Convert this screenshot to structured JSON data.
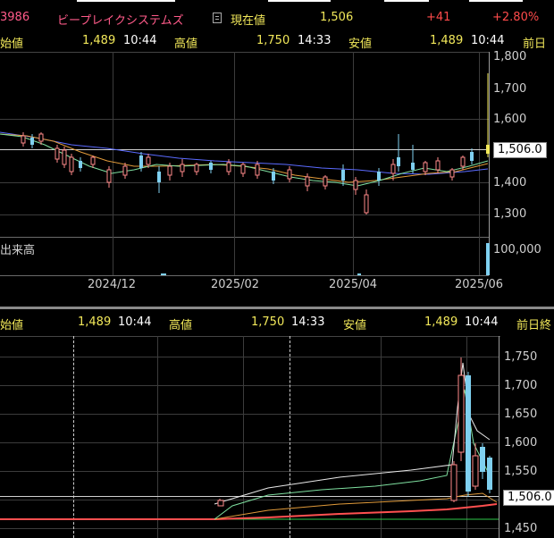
{
  "header": {
    "code": "3986",
    "name": "ビープレイクシステムズ",
    "current_label": "現在値",
    "current_value": "1,506",
    "change": "+41",
    "change_pct": "+2.80%"
  },
  "top_stats": {
    "open_label": "始値",
    "open_value": "1,489",
    "open_time": "10:44",
    "high_label": "高値",
    "high_value": "1,750",
    "high_time": "14:33",
    "low_label": "安値",
    "low_value": "1,489",
    "low_time": "10:44",
    "prev_label": "前日"
  },
  "daily_chart": {
    "y_ticks": [
      "1,800",
      "1,700",
      "1,600",
      "1,506.0",
      "1,400",
      "1,300"
    ],
    "volume_label": "出来高",
    "volume_tick": "100,000",
    "x_ticks": [
      "2024/12",
      "2025/02",
      "2025/04",
      "2025/06"
    ]
  },
  "bottom_stats": {
    "open_label": "始値",
    "open_value": "1,489",
    "open_time": "10:44",
    "high_label": "高値",
    "high_value": "1,750",
    "high_time": "14:33",
    "low_label": "安値",
    "low_value": "1,489",
    "low_time": "10:44",
    "prev_label": "前日終"
  },
  "intraday_chart": {
    "y_ticks": [
      "1,750",
      "1,700",
      "1,650",
      "1,600",
      "1,550",
      "1,506.0",
      "1,450"
    ]
  },
  "colors": {
    "accent_yellow": "#f2e85a",
    "up_red": "#ff4b4b",
    "name_pink": "#ff5b8a",
    "candle_blue": "#7fd0f0"
  }
}
